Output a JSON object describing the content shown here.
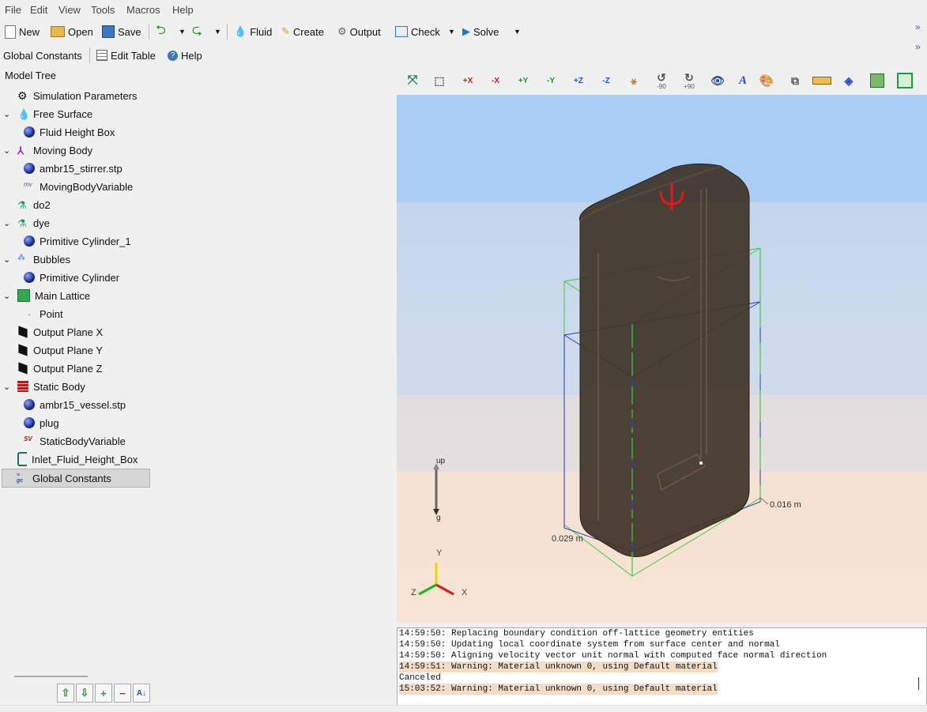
{
  "menu": {
    "file": "File",
    "edit": "Edit",
    "view": "View",
    "tools": "Tools",
    "macros": "Macros",
    "help": "Help"
  },
  "toolbar": {
    "new": "New",
    "open": "Open",
    "save": "Save",
    "fluid": "Fluid",
    "create": "Create",
    "output": "Output",
    "check": "Check",
    "solve": "Solve"
  },
  "toolbar2": {
    "global_constants": "Global Constants",
    "edit_table": "Edit Table",
    "help": "Help"
  },
  "tree": {
    "title": "Model Tree",
    "items": [
      "Simulation Parameters",
      "Free Surface",
      "Fluid Height Box",
      "Moving Body",
      "ambr15_stirrer.stp",
      "MovingBodyVariable",
      "do2",
      "dye",
      "Primitive Cylinder_1",
      "Bubbles",
      "Primitive Cylinder",
      "Main Lattice",
      "Point",
      "Output Plane X",
      "Output Plane Y",
      "Output Plane Z",
      "Static Body",
      "ambr15_vessel.stp",
      "plug",
      "StaticBodyVariable",
      "Inlet_Fluid_Height_Box",
      "Global Constants"
    ]
  },
  "view_toolbar": {
    "x_plus": "+X",
    "x_minus": "-X",
    "y_plus": "+Y",
    "y_minus": "-Y",
    "z_plus": "+Z",
    "z_minus": "-Z",
    "rot_minus": "-90",
    "rot_plus": "+90"
  },
  "viewport": {
    "dim_x": "0.029 m",
    "dim_z": "0.016 m",
    "gravity_up": "up",
    "gravity_down": "g",
    "axis_y": "Y",
    "axis_x": "X",
    "axis_z": "Z"
  },
  "console": {
    "lines": [
      {
        "text": "14:59:50: Replacing boundary condition off-lattice geometry entities",
        "warn": false
      },
      {
        "text": "14:59:50: Updating local coordinate system from surface center and normal",
        "warn": false
      },
      {
        "text": "14:59:50: Aligning velocity vector unit normal with computed face normal direction",
        "warn": false
      },
      {
        "text": "14:59:51: Warning: Material unknown 0, using Default material",
        "warn": true
      },
      {
        "text": "Canceled",
        "warn": false
      },
      {
        "text": "15:03:52: Warning: Material unknown 0, using Default material",
        "warn": true
      }
    ]
  },
  "colors": {
    "viewport_sky": "#aacdf4",
    "viewport_ground": "#f6e3d4",
    "vessel": "#3e3328",
    "selection": "#d6d6d6"
  }
}
